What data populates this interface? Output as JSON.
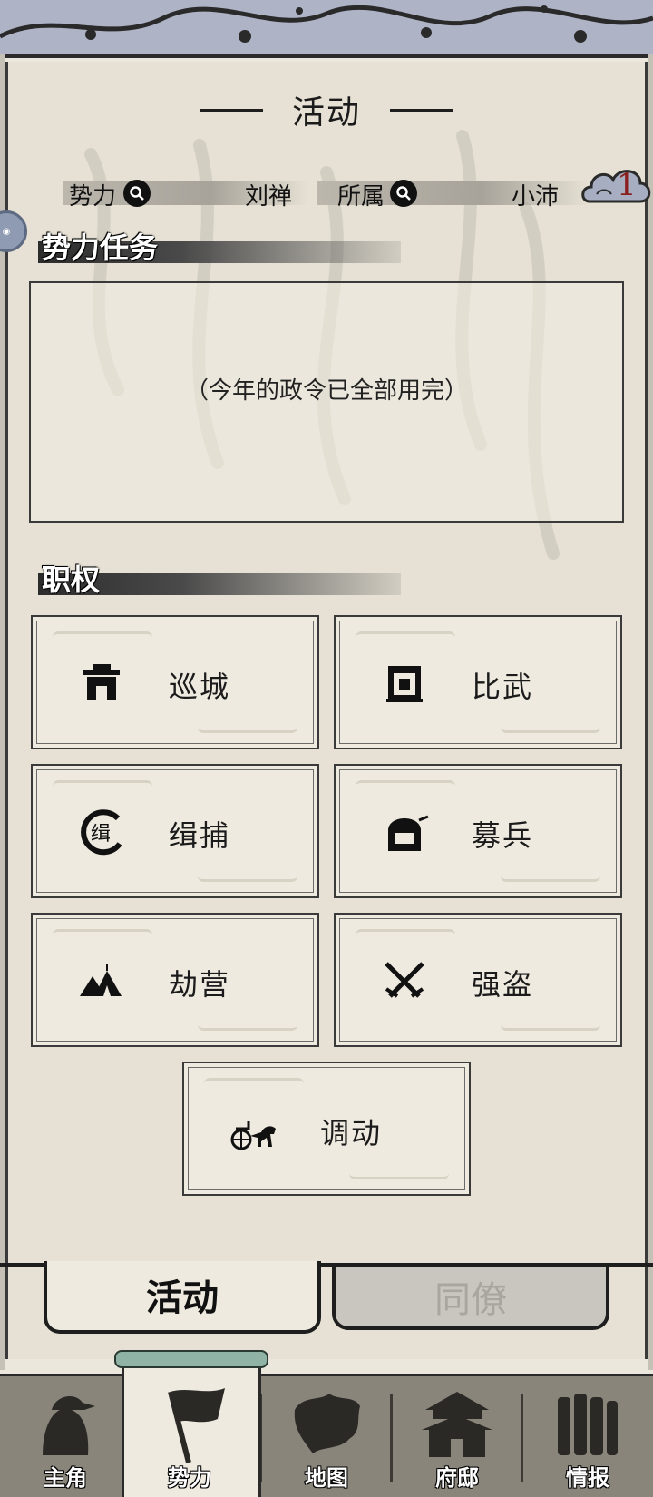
{
  "header": {
    "title": "活动"
  },
  "info_bar": {
    "faction_label": "势力",
    "faction_value": "刘禅",
    "belong_label": "所属",
    "belong_value": "小沛",
    "badge_count": "1"
  },
  "tasks": {
    "section_title": "势力任务",
    "empty_message": "（今年的政令已全部用完）"
  },
  "powers": {
    "section_title": "职权",
    "items": [
      {
        "label": "巡城",
        "icon": "city-gate-icon"
      },
      {
        "label": "比武",
        "icon": "arena-icon"
      },
      {
        "label": "缉捕",
        "icon": "arrest-seal-icon"
      },
      {
        "label": "募兵",
        "icon": "soldier-helmet-icon"
      },
      {
        "label": "劫营",
        "icon": "camp-tents-icon"
      },
      {
        "label": "强盗",
        "icon": "crossed-swords-icon"
      },
      {
        "label": "调动",
        "icon": "chariot-icon"
      }
    ]
  },
  "sub_tabs": [
    {
      "label": "活动",
      "active": true
    },
    {
      "label": "同僚",
      "active": false
    }
  ],
  "nav": [
    {
      "label": "主角",
      "icon": "hero-portrait-icon"
    },
    {
      "label": "势力",
      "icon": "faction-flag-icon",
      "active": true
    },
    {
      "label": "地图",
      "icon": "map-icon"
    },
    {
      "label": "府邸",
      "icon": "mansion-icon"
    },
    {
      "label": "情报",
      "icon": "scrolls-icon"
    }
  ],
  "colors": {
    "paper": "#e6e1d4",
    "ink": "#1b1b1b",
    "badge_red": "#8a1f1f",
    "nav_bg": "#8a857b",
    "top_band": "#aeb4c6"
  }
}
